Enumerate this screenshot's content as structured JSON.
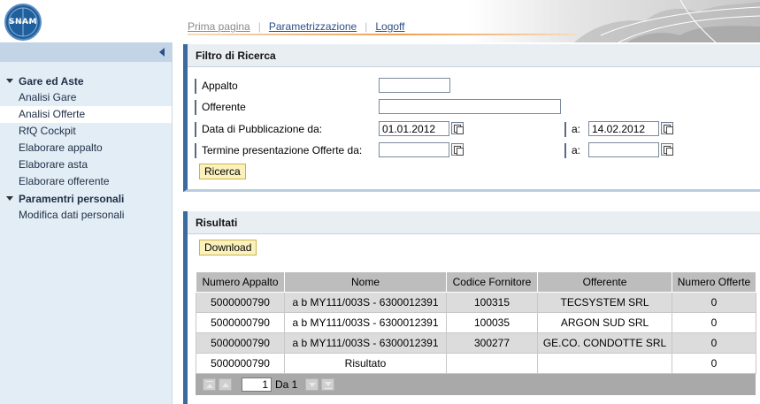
{
  "header": {
    "logo_text": "SNAM",
    "nav": [
      "Prima pagina",
      "Parametrizzazione",
      "Logoff"
    ]
  },
  "sidebar": {
    "groups": [
      {
        "label": "Gare ed Aste",
        "items": [
          "Analisi Gare",
          "Analisi Offerte",
          "RfQ Cockpit",
          "Elaborare appalto",
          "Elaborare asta",
          "Elaborare offerente"
        ]
      },
      {
        "label": "Paramentri personali",
        "items": [
          "Modifica dati personali"
        ]
      }
    ],
    "selected_item": "Analisi Offerte"
  },
  "filter": {
    "title": "Filtro di Ricerca",
    "appalto_label": "Appalto",
    "appalto_value": "",
    "offerente_label": "Offerente",
    "offerente_value": "",
    "pub_label": "Data di Pubblicazione da:",
    "pub_from": "01.01.2012",
    "pub_to_label": "a:",
    "pub_to": "14.02.2012",
    "term_label": "Termine presentazione Offerte da:",
    "term_from": "",
    "term_to_label": "a:",
    "term_to": "",
    "search_button": "Ricerca"
  },
  "results": {
    "title": "Risultati",
    "download_button": "Download",
    "columns": [
      "Numero Appalto",
      "Nome",
      "Codice Fornitore",
      "Offerente",
      "Numero Offerte"
    ],
    "rows": [
      [
        "5000000790",
        "a b MY111/003S - 6300012391",
        "100315",
        "TECSYSTEM SRL",
        "0"
      ],
      [
        "5000000790",
        "a b MY111/003S - 6300012391",
        "100035",
        "ARGON SUD SRL",
        "0"
      ],
      [
        "5000000790",
        "a b MY111/003S - 6300012391",
        "300277",
        "GE.CO. CONDOTTE SRL",
        "0"
      ],
      [
        "5000000790",
        "Risultato",
        "",
        "",
        "0"
      ]
    ],
    "pager": {
      "page": "1",
      "of_label": "Da 1"
    }
  },
  "colors": {
    "accent": "#3a6aa0",
    "sidebar_bg": "#e3edf6",
    "button_bg": "#fbf1bd",
    "header_row": "#bdbdbd",
    "pager_bg": "#a9a9a9"
  }
}
